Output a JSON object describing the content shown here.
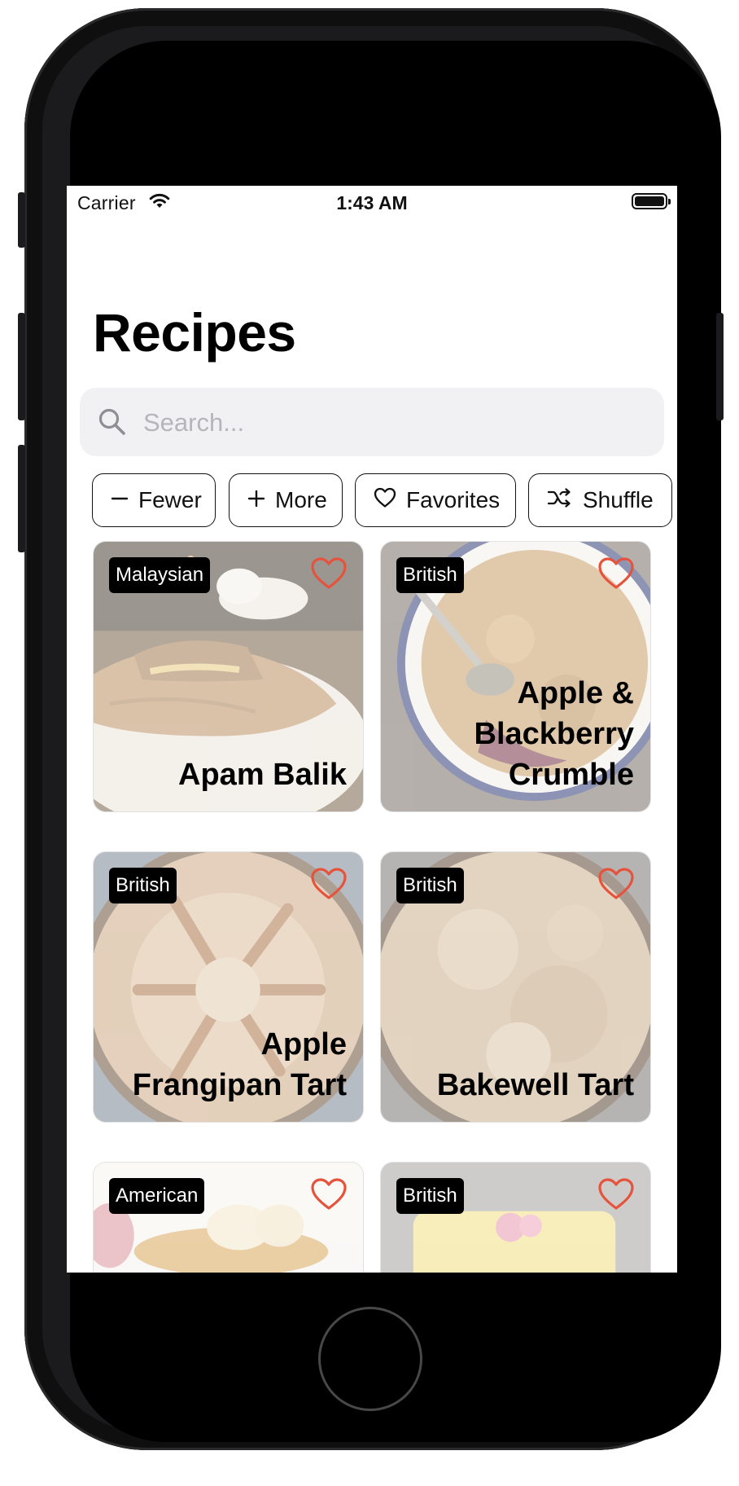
{
  "status_bar": {
    "carrier": "Carrier",
    "time": "1:43 AM"
  },
  "screen_title": "Recipes",
  "search": {
    "placeholder": "Search..."
  },
  "filters": [
    {
      "label": "Fewer",
      "icon": "minus-icon"
    },
    {
      "label": "More",
      "icon": "plus-icon"
    },
    {
      "label": "Favorites",
      "icon": "heart-icon"
    },
    {
      "label": "Shuffle",
      "icon": "shuffle-icon"
    }
  ],
  "recipes": [
    {
      "cuisine": "Malaysian",
      "name": "Apam Balik",
      "favorite": false
    },
    {
      "cuisine": "British",
      "name": "Apple & Blackberry Crumble",
      "favorite": false
    },
    {
      "cuisine": "British",
      "name": "Apple Frangipan Tart",
      "favorite": false
    },
    {
      "cuisine": "British",
      "name": "Bakewell Tart",
      "favorite": false
    },
    {
      "cuisine": "American",
      "name": "",
      "favorite": false
    },
    {
      "cuisine": "British",
      "name": "",
      "favorite": false
    }
  ],
  "colors": {
    "accent_heart": "#e5533d",
    "chip_border": "#111111",
    "search_bg": "#f1f1f4"
  }
}
